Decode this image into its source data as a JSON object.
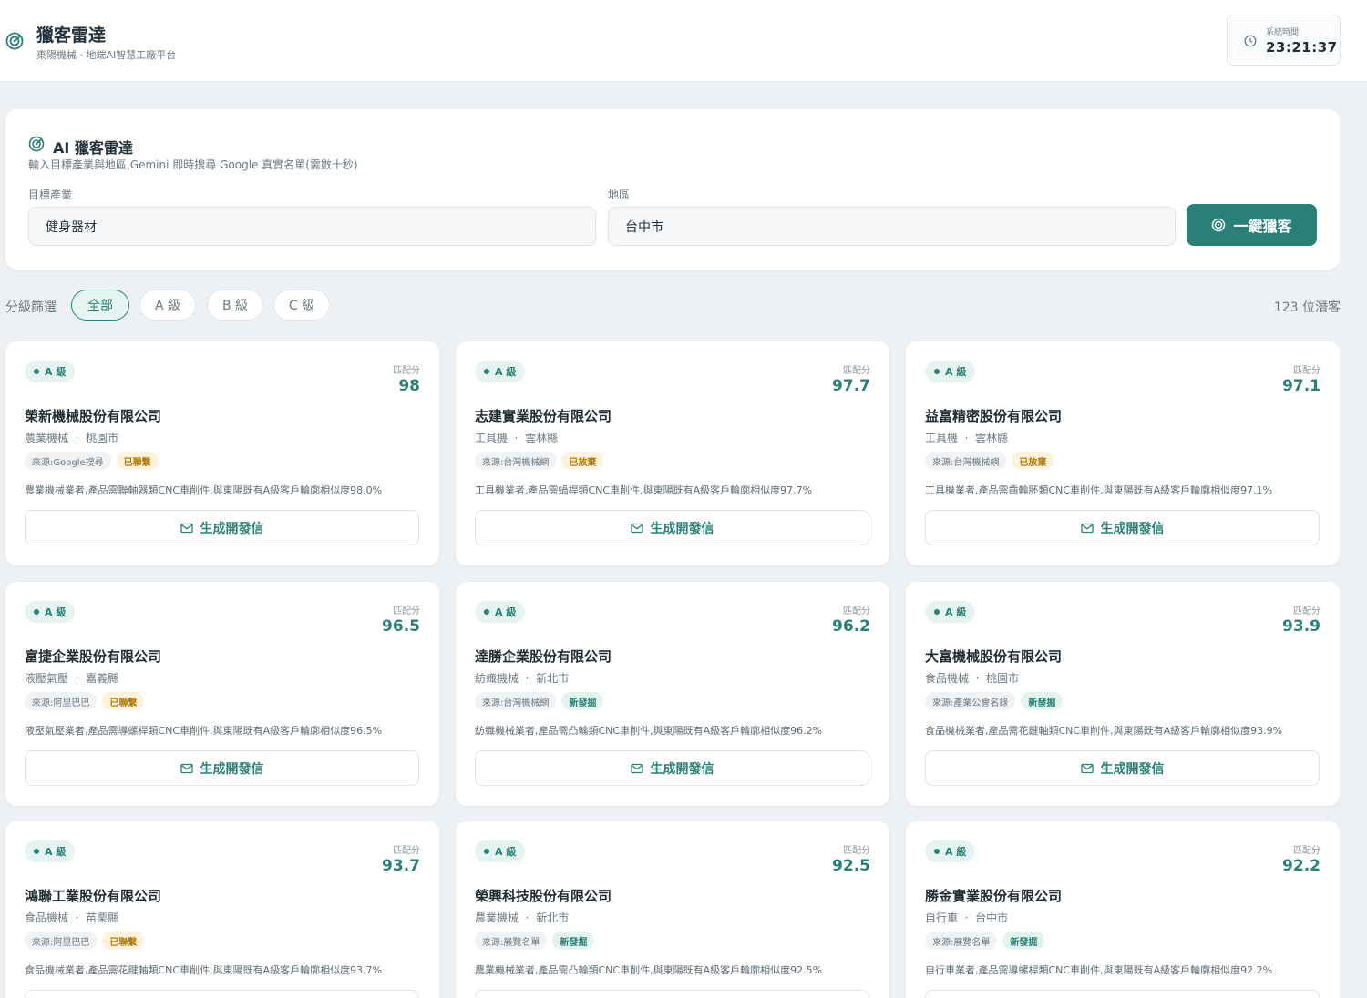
{
  "header": {
    "title": "獵客雷達",
    "subtitle": "東陽機械 · 地端AI智慧工廠平台",
    "clock_label": "系統時間",
    "clock_time": "23:21:37"
  },
  "search": {
    "title": "AI 獵客雷達",
    "subtitle": "輸入目標產業與地區,Gemini 即時搜尋 Google 真實名單(需數十秒)",
    "industry_label": "目標產業",
    "industry_value": "健身器材",
    "region_label": "地區",
    "region_value": "台中市",
    "button_label": "一鍵獵客"
  },
  "filter": {
    "label": "分級篩選",
    "chips": [
      "全部",
      "A 級",
      "B 級",
      "C 級"
    ],
    "active": "全部",
    "count_text": "123 位潛客"
  },
  "card_common": {
    "score_label": "匹配分",
    "generate_label": "生成開發信"
  },
  "leads": [
    {
      "grade": "A 級",
      "score": "98",
      "company": "榮新機械股份有限公司",
      "industry": "農業機械",
      "region": "桃園市",
      "source": "來源:Google搜尋",
      "status": "已聯繫",
      "status_type": "contacted",
      "description": "農業機械業者,產品需聯軸器類CNC車削件,與東陽既有A級客戶輪廓相似度98.0%"
    },
    {
      "grade": "A 級",
      "score": "97.7",
      "company": "志建實業股份有限公司",
      "industry": "工具機",
      "region": "雲林縣",
      "source": "來源:台灣機械網",
      "status": "已放棄",
      "status_type": "abandoned",
      "description": "工具機業者,產品需蝸桿類CNC車削件,與東陽既有A級客戶輪廓相似度97.7%"
    },
    {
      "grade": "A 級",
      "score": "97.1",
      "company": "益富精密股份有限公司",
      "industry": "工具機",
      "region": "雲林縣",
      "source": "來源:台灣機械網",
      "status": "已放棄",
      "status_type": "abandoned",
      "description": "工具機業者,產品需齒輪胚類CNC車削件,與東陽既有A級客戶輪廓相似度97.1%"
    },
    {
      "grade": "A 級",
      "score": "96.5",
      "company": "富捷企業股份有限公司",
      "industry": "液壓氣壓",
      "region": "嘉義縣",
      "source": "來源:阿里巴巴",
      "status": "已聯繫",
      "status_type": "contacted",
      "description": "液壓氣壓業者,產品需導螺桿類CNC車削件,與東陽既有A級客戶輪廓相似度96.5%"
    },
    {
      "grade": "A 級",
      "score": "96.2",
      "company": "達勝企業股份有限公司",
      "industry": "紡織機械",
      "region": "新北市",
      "source": "來源:台灣機械網",
      "status": "新發掘",
      "status_type": "new",
      "description": "紡織機械業者,產品需凸輪類CNC車削件,與東陽既有A級客戶輪廓相似度96.2%"
    },
    {
      "grade": "A 級",
      "score": "93.9",
      "company": "大富機械股份有限公司",
      "industry": "食品機械",
      "region": "桃園市",
      "source": "來源:產業公會名錄",
      "status": "新發掘",
      "status_type": "new",
      "description": "食品機械業者,產品需花鍵軸類CNC車削件,與東陽既有A級客戶輪廓相似度93.9%"
    },
    {
      "grade": "A 級",
      "score": "93.7",
      "company": "鴻聯工業股份有限公司",
      "industry": "食品機械",
      "region": "苗栗縣",
      "source": "來源:阿里巴巴",
      "status": "已聯繫",
      "status_type": "contacted",
      "description": "食品機械業者,產品需花鍵軸類CNC車削件,與東陽既有A級客戶輪廓相似度93.7%"
    },
    {
      "grade": "A 級",
      "score": "92.5",
      "company": "榮興科技股份有限公司",
      "industry": "農業機械",
      "region": "新北市",
      "source": "來源:展覽名單",
      "status": "新發掘",
      "status_type": "new",
      "description": "農業機械業者,產品需凸輪類CNC車削件,與東陽既有A級客戶輪廓相似度92.5%"
    },
    {
      "grade": "A 級",
      "score": "92.2",
      "company": "勝金實業股份有限公司",
      "industry": "自行車",
      "region": "台中市",
      "source": "來源:展覽名單",
      "status": "新發掘",
      "status_type": "new",
      "description": "自行車業者,產品需導螺桿類CNC車削件,與東陽既有A級客戶輪廓相似度92.2%"
    }
  ],
  "icons": {
    "brand": "radar-icon",
    "clock": "clock-icon",
    "hunt": "target-icon",
    "generate": "mail-icon"
  },
  "colors": {
    "accent": "#2a8077",
    "background": "#eef1f4",
    "status_contacted": "#b8790b",
    "status_new": "#2a8077"
  }
}
